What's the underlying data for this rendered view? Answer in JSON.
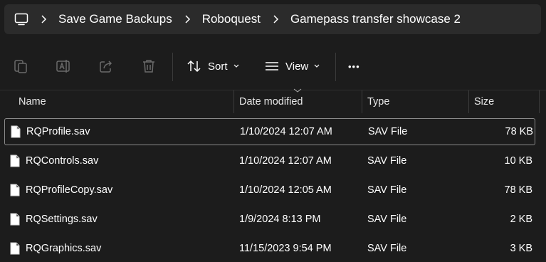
{
  "address_bar": {
    "icon": "computer-icon",
    "breadcrumbs": [
      "Save Game Backups",
      "Roboquest",
      "Gamepass transfer showcase 2"
    ]
  },
  "toolbar": {
    "icons": [
      "copy-icon",
      "rename-icon",
      "share-icon",
      "delete-icon"
    ],
    "sort_label": "Sort",
    "view_label": "View",
    "more_label": "•••"
  },
  "columns": {
    "name": "Name",
    "date": "Date modified",
    "type": "Type",
    "size": "Size"
  },
  "files": [
    {
      "name": "RQProfile.sav",
      "date": "1/10/2024 12:07 AM",
      "type": "SAV File",
      "size": "78 KB"
    },
    {
      "name": "RQControls.sav",
      "date": "1/10/2024 12:07 AM",
      "type": "SAV File",
      "size": "10 KB"
    },
    {
      "name": "RQProfileCopy.sav",
      "date": "1/10/2024 12:05 AM",
      "type": "SAV File",
      "size": "78 KB"
    },
    {
      "name": "RQSettings.sav",
      "date": "1/9/2024 8:13 PM",
      "type": "SAV File",
      "size": "2 KB"
    },
    {
      "name": "RQGraphics.sav",
      "date": "11/15/2023 9:54 PM",
      "type": "SAV File",
      "size": "3 KB"
    }
  ],
  "colors": {
    "background": "#1c1c1c",
    "address_bar": "#2b2b2b",
    "text": "#ffffff",
    "disabled_icon": "#6b6b6b",
    "selection_border": "#8a8a8a"
  }
}
